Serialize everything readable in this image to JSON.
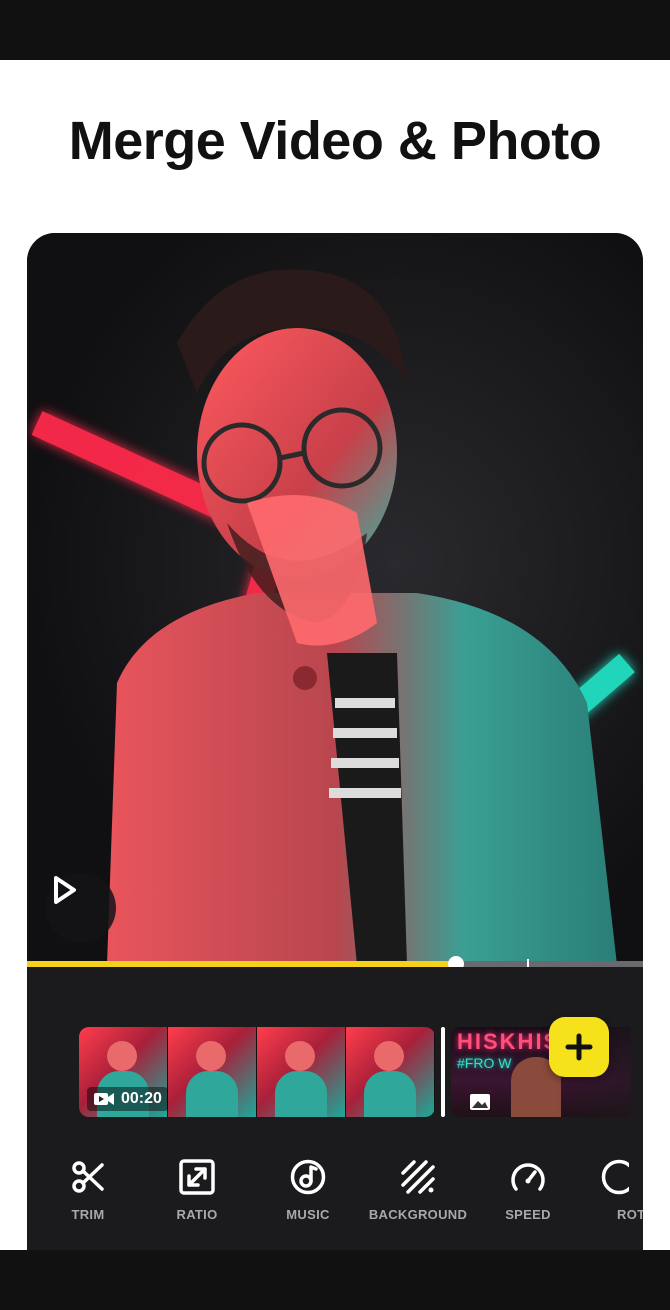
{
  "headline": "Merge Video & Photo",
  "player": {
    "progress_fraction": 0.696,
    "play_icon": "play-icon"
  },
  "timeline": {
    "clip_duration": "00:20",
    "second_clip_text": "HISKHISK",
    "second_clip_subtext": "#FRO     W",
    "add_icon": "plus-icon"
  },
  "toolbar": {
    "items": [
      {
        "label": "TRIM",
        "icon": "scissors-icon"
      },
      {
        "label": "RATIO",
        "icon": "ratio-icon"
      },
      {
        "label": "MUSIC",
        "icon": "music-icon"
      },
      {
        "label": "BACKGROUND",
        "icon": "background-icon"
      },
      {
        "label": "SPEED",
        "icon": "speed-icon"
      },
      {
        "label": "ROT",
        "icon": "rotate-icon"
      }
    ]
  },
  "colors": {
    "accent_yellow": "#f5d11a",
    "neon_red": "#ff2a4c",
    "neon_teal": "#22e0c4",
    "panel": "#1b1b1d"
  }
}
